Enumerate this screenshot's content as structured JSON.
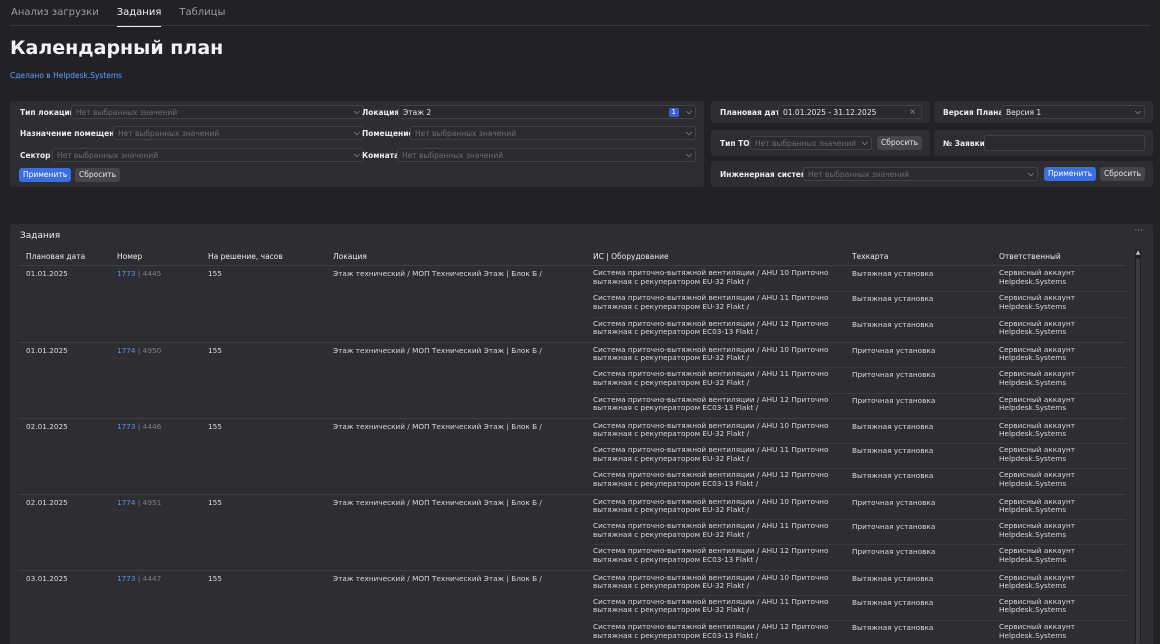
{
  "tabs": [
    "Анализ загрузки",
    "Задания",
    "Таблицы"
  ],
  "page": {
    "title": "Календарный план",
    "made_by": "Сделано в Helpdesk.Systems"
  },
  "filters": {
    "location_type": {
      "label": "Тип локации",
      "placeholder": "Нет выбранных значений"
    },
    "location": {
      "label": "Локация",
      "value": "Этаж 2",
      "count": "1"
    },
    "room_purpose": {
      "label": "Назначение помещения",
      "placeholder": "Нет выбранных значений"
    },
    "room": {
      "label": "Помещение",
      "placeholder": "Нет выбранных значений"
    },
    "sector": {
      "label": "Сектор",
      "placeholder": "Нет выбранных значений"
    },
    "chamber": {
      "label": "Комната",
      "placeholder": "Нет выбранных значений"
    },
    "apply": "Применить",
    "reset": "Сбросить",
    "plan_date": {
      "label": "Плановая дата",
      "value": "01.01.2025 - 31.12.2025"
    },
    "plan_version": {
      "label": "Версия Плана*",
      "value": "Версия 1"
    },
    "to_type": {
      "label": "Тип ТО",
      "placeholder": "Нет выбранных значений",
      "reset": "Сбросить"
    },
    "request_no": {
      "label": "№ Заявки",
      "value": ""
    },
    "eng_system": {
      "label": "Инженерная система",
      "placeholder": "Нет выбранных значений",
      "apply": "Применить",
      "reset": "Сбросить"
    }
  },
  "tasks": {
    "title": "Задания",
    "menu": "···",
    "columns": [
      "Плановая дата",
      "Номер",
      "На решение, часов",
      "Локация",
      "ИС | Оборудование",
      "Техкарта",
      "Ответственный"
    ],
    "rows": [
      {
        "date": "01.01.2025",
        "num": "1773",
        "num2": " | 4445",
        "hours": "155",
        "location": "Этаж технический / МОП Технический Этаж | Блок Б /",
        "items": [
          {
            "eq": "Система приточно-вытяжной вентиляции / AHU 10 Приточно вытяжная с рекуператором EU-32 Flakt /",
            "card": "Вытяжная установка",
            "resp": "Сервисный аккаунт Helpdesk.Systems"
          },
          {
            "eq": "Система приточно-вытяжной вентиляции / AHU 11 Приточно вытяжная с рекуператором EU-32 Flakt /",
            "card": "Вытяжная установка",
            "resp": "Сервисный аккаунт Helpdesk.Systems"
          },
          {
            "eq": "Система приточно-вытяжной вентиляции / AHU 12 Приточно вытяжная с рекуператором EC03-13 Flakt /",
            "card": "Вытяжная установка",
            "resp": "Сервисный аккаунт Helpdesk.Systems"
          }
        ]
      },
      {
        "date": "01.01.2025",
        "num": "1774",
        "num2": " | 4950",
        "hours": "155",
        "location": "Этаж технический / МОП Технический Этаж | Блок Б /",
        "items": [
          {
            "eq": "Система приточно-вытяжной вентиляции / AHU 10 Приточно вытяжная с рекуператором EU-32 Flakt /",
            "card": "Приточная установка",
            "resp": "Сервисный аккаунт Helpdesk.Systems"
          },
          {
            "eq": "Система приточно-вытяжной вентиляции / AHU 11 Приточно вытяжная с рекуператором EU-32 Flakt /",
            "card": "Приточная установка",
            "resp": "Сервисный аккаунт Helpdesk.Systems"
          },
          {
            "eq": "Система приточно-вытяжной вентиляции / AHU 12 Приточно вытяжная с рекуператором EC03-13 Flakt /",
            "card": "Приточная установка",
            "resp": "Сервисный аккаунт Helpdesk.Systems"
          }
        ]
      },
      {
        "date": "02.01.2025",
        "num": "1773",
        "num2": " | 4446",
        "hours": "155",
        "location": "Этаж технический / МОП Технический Этаж | Блок Б /",
        "items": [
          {
            "eq": "Система приточно-вытяжной вентиляции / AHU 10 Приточно вытяжная с рекуператором EU-32 Flakt /",
            "card": "Вытяжная установка",
            "resp": "Сервисный аккаунт Helpdesk.Systems"
          },
          {
            "eq": "Система приточно-вытяжной вентиляции / AHU 11 Приточно вытяжная с рекуператором EU-32 Flakt /",
            "card": "Вытяжная установка",
            "resp": "Сервисный аккаунт Helpdesk.Systems"
          },
          {
            "eq": "Система приточно-вытяжной вентиляции / AHU 12 Приточно вытяжная с рекуператором EC03-13 Flakt /",
            "card": "Вытяжная установка",
            "resp": "Сервисный аккаунт Helpdesk.Systems"
          }
        ]
      },
      {
        "date": "02.01.2025",
        "num": "1774",
        "num2": " | 4951",
        "hours": "155",
        "location": "Этаж технический / МОП Технический Этаж | Блок Б /",
        "items": [
          {
            "eq": "Система приточно-вытяжной вентиляции / AHU 10 Приточно вытяжная с рекуператором EU-32 Flakt /",
            "card": "Приточная установка",
            "resp": "Сервисный аккаунт Helpdesk.Systems"
          },
          {
            "eq": "Система приточно-вытяжной вентиляции / AHU 11 Приточно вытяжная с рекуператором EU-32 Flakt /",
            "card": "Приточная установка",
            "resp": "Сервисный аккаунт Helpdesk.Systems"
          },
          {
            "eq": "Система приточно-вытяжной вентиляции / AHU 12 Приточно вытяжная с рекуператором EC03-13 Flakt /",
            "card": "Приточная установка",
            "resp": "Сервисный аккаунт Helpdesk.Systems"
          }
        ]
      },
      {
        "date": "03.01.2025",
        "num": "1773",
        "num2": " | 4447",
        "hours": "155",
        "location": "Этаж технический / МОП Технический Этаж | Блок Б /",
        "items": [
          {
            "eq": "Система приточно-вытяжной вентиляции / AHU 10 Приточно вытяжная с рекуператором EU-32 Flakt /",
            "card": "Вытяжная установка",
            "resp": "Сервисный аккаунт Helpdesk.Systems"
          },
          {
            "eq": "Система приточно-вытяжной вентиляции / AHU 11 Приточно вытяжная с рекуператором EU-32 Flakt /",
            "card": "Вытяжная установка",
            "resp": "Сервисный аккаунт Helpdesk.Systems"
          },
          {
            "eq": "Система приточно-вытяжной вентиляции / AHU 12 Приточно вытяжная с рекуператором EC03-13 Flakt /",
            "card": "Вытяжная установка",
            "resp": "Сервисный аккаунт Helpdesk.Systems"
          }
        ]
      }
    ]
  }
}
